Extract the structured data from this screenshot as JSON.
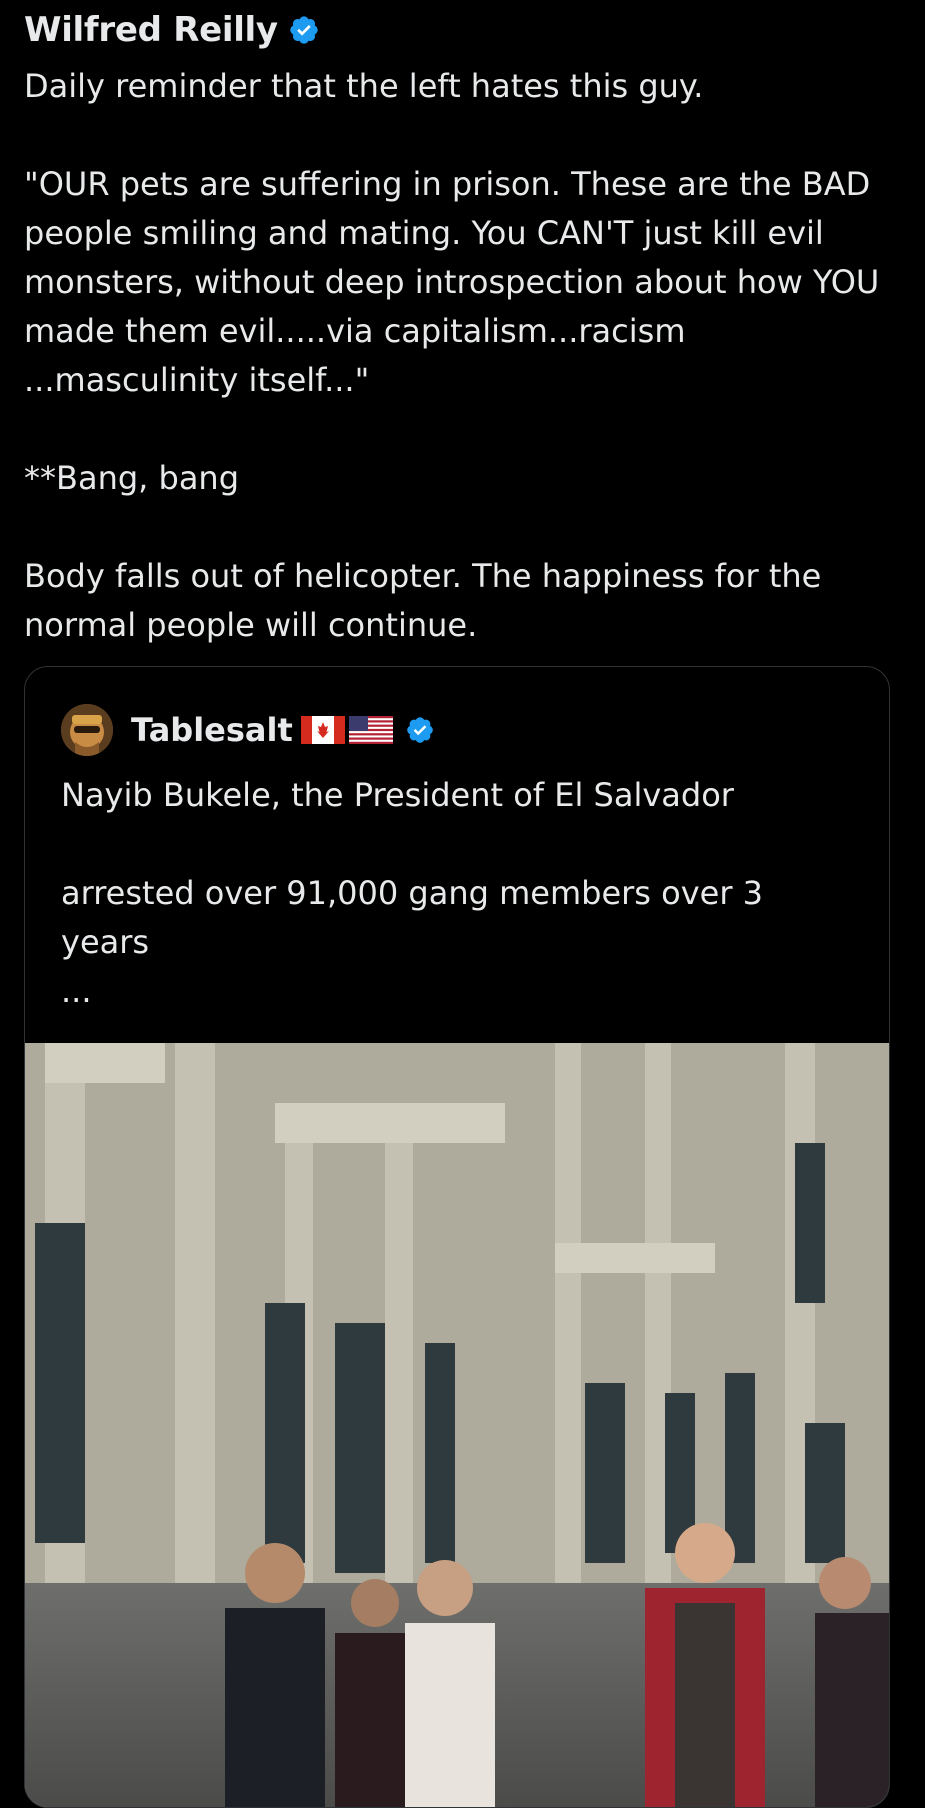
{
  "tweet": {
    "author_name": "Wilfred Reilly",
    "text": "Daily reminder that the left hates this guy.\n\n\"OUR pets are suffering in prison. These are the BAD people smiling and mating. You CAN'T just kill evil monsters, without deep introspection about how YOU made them evil.....via capitalism...racism ...masculinity itself...\"\n\n**Bang, bang\n\nBody falls out of helicopter. The happiness for the normal people will continue."
  },
  "quoted_tweet": {
    "author_name": "Tablesalt",
    "flags": [
      "flag-canada-icon",
      "flag-usa-icon"
    ],
    "text": "Nayib Bukele, the President of El Salvador\n\narrested over 91,000 gang members over 3 years\n..."
  },
  "colors": {
    "background": "#000000",
    "text": "#e7e9ea",
    "verified": "#1d9bf0",
    "border": "#2f3336"
  }
}
